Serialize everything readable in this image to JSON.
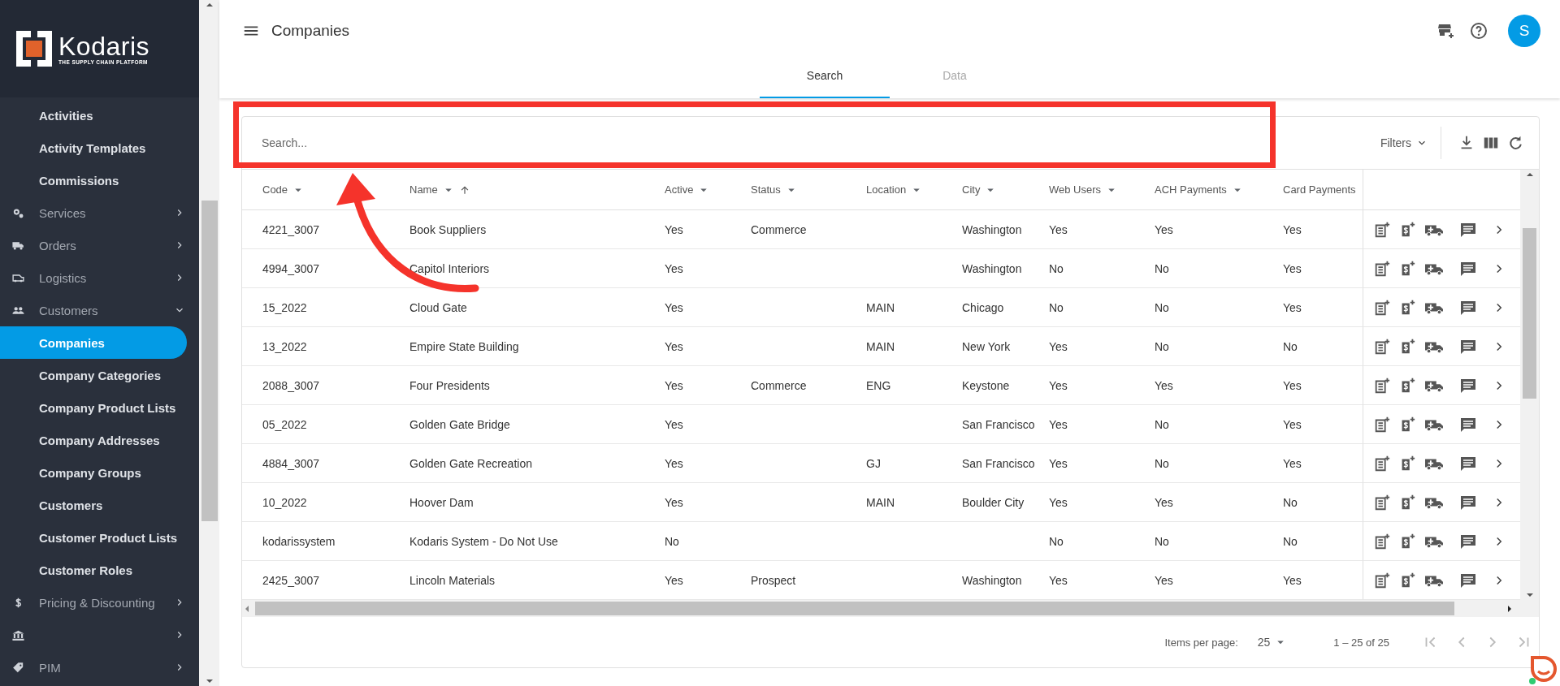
{
  "sidebar": {
    "logo": {
      "name": "Kodaris",
      "tagline": "THE SUPPLY CHAIN PLATFORM"
    },
    "items": [
      {
        "kind": "link",
        "label": "Activities",
        "selected": false
      },
      {
        "kind": "link",
        "label": "Activity Templates",
        "selected": false
      },
      {
        "kind": "link",
        "label": "Commissions",
        "selected": false
      },
      {
        "kind": "section",
        "label": "Services",
        "expanded": false
      },
      {
        "kind": "section",
        "label": "Orders",
        "expanded": false
      },
      {
        "kind": "section",
        "label": "Logistics",
        "expanded": false
      },
      {
        "kind": "section",
        "label": "Customers",
        "expanded": true
      },
      {
        "kind": "link",
        "label": "Companies",
        "selected": true
      },
      {
        "kind": "link",
        "label": "Company Categories",
        "selected": false
      },
      {
        "kind": "link",
        "label": "Company Product Lists",
        "selected": false
      },
      {
        "kind": "link",
        "label": "Company Addresses",
        "selected": false
      },
      {
        "kind": "link",
        "label": "Company Groups",
        "selected": false
      },
      {
        "kind": "link",
        "label": "Customers",
        "selected": false
      },
      {
        "kind": "link",
        "label": "Customer Product Lists",
        "selected": false
      },
      {
        "kind": "link",
        "label": "Customer Roles",
        "selected": false
      },
      {
        "kind": "section",
        "label": "Pricing & Discounting",
        "expanded": false
      },
      {
        "kind": "section",
        "expanded": false
      },
      {
        "kind": "section",
        "label": "PIM",
        "expanded": false
      }
    ]
  },
  "header": {
    "title": "Companies",
    "avatar": "S"
  },
  "tabs": [
    {
      "label": "Search",
      "selected": true
    },
    {
      "label": "Data",
      "selected": false
    }
  ],
  "search": {
    "placeholder": "Search...",
    "filters": "Filters"
  },
  "table": {
    "columns": [
      {
        "label": "Code",
        "sorted": false
      },
      {
        "label": "Name",
        "sorted": true
      },
      {
        "label": "Active",
        "sorted": false
      },
      {
        "label": "Status",
        "sorted": false
      },
      {
        "label": "Location",
        "sorted": false
      },
      {
        "label": "City",
        "sorted": false
      },
      {
        "label": "Web Users",
        "sorted": false
      },
      {
        "label": "ACH Payments",
        "sorted": false
      },
      {
        "label": "Card Payments",
        "sorted": false
      }
    ],
    "rows": [
      [
        "4221_3007",
        "Book Suppliers",
        "Yes",
        "Commerce",
        "",
        "Washington",
        "Yes",
        "Yes",
        "Yes"
      ],
      [
        "4994_3007",
        "Capitol Interiors",
        "Yes",
        "",
        "",
        "Washington",
        "No",
        "No",
        "Yes"
      ],
      [
        "15_2022",
        "Cloud Gate",
        "Yes",
        "",
        "MAIN",
        "Chicago",
        "No",
        "No",
        "Yes"
      ],
      [
        "13_2022",
        "Empire State Building",
        "Yes",
        "",
        "MAIN",
        "New York",
        "Yes",
        "No",
        "No"
      ],
      [
        "2088_3007",
        "Four Presidents",
        "Yes",
        "Commerce",
        "ENG",
        "Keystone",
        "Yes",
        "Yes",
        "Yes"
      ],
      [
        "05_2022",
        "Golden Gate Bridge",
        "Yes",
        "",
        "",
        "San Francisco",
        "Yes",
        "No",
        "Yes"
      ],
      [
        "4884_3007",
        "Golden Gate Recreation",
        "Yes",
        "",
        "GJ",
        "San Francisco",
        "Yes",
        "No",
        "Yes"
      ],
      [
        "10_2022",
        "Hoover Dam",
        "Yes",
        "",
        "MAIN",
        "Boulder City",
        "Yes",
        "Yes",
        "No"
      ],
      [
        "kodarissystem",
        "Kodaris System - Do Not Use",
        "No",
        "",
        "",
        "",
        "No",
        "No",
        "No"
      ],
      [
        "2425_3007",
        "Lincoln Materials",
        "Yes",
        "Prospect",
        "",
        "Washington",
        "Yes",
        "Yes",
        "Yes"
      ]
    ]
  },
  "pagination": {
    "label": "Items per page:",
    "page_size": "25",
    "range": "1 – 25 of 25"
  }
}
